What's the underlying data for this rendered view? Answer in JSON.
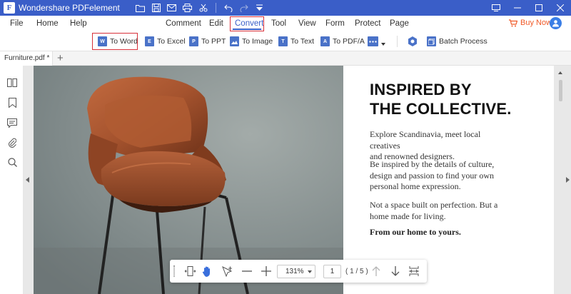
{
  "app": {
    "title": "Wondershare PDFelement"
  },
  "quick_access": [
    {
      "name": "open-folder-icon"
    },
    {
      "name": "save-icon"
    },
    {
      "name": "email-icon"
    },
    {
      "name": "print-icon"
    },
    {
      "name": "scissors-icon"
    },
    {
      "name": "undo-icon"
    },
    {
      "name": "redo-icon"
    },
    {
      "name": "customize-dropdown-icon"
    }
  ],
  "menu": {
    "items": [
      {
        "label": "File"
      },
      {
        "label": "Home"
      },
      {
        "label": "Help"
      },
      {
        "label": "Comment"
      },
      {
        "label": "Edit"
      },
      {
        "label": "Convert"
      },
      {
        "label": "Tool"
      },
      {
        "label": "View"
      },
      {
        "label": "Form"
      },
      {
        "label": "Protect"
      },
      {
        "label": "Page"
      }
    ],
    "active": "Convert",
    "buy_now": "Buy Now"
  },
  "toolbar": {
    "items": [
      {
        "label": "To Word",
        "icon": "W",
        "color": "#4a72c8"
      },
      {
        "label": "To Excel",
        "icon": "E",
        "color": "#4a72c8"
      },
      {
        "label": "To PPT",
        "icon": "P",
        "color": "#4a72c8"
      },
      {
        "label": "To Image",
        "icon": "img",
        "color": "#4a72c8"
      },
      {
        "label": "To Text",
        "icon": "T",
        "color": "#4a72c8"
      },
      {
        "label": "To PDF/A",
        "icon": "A",
        "color": "#4a72c8"
      }
    ],
    "batch": "Batch Process"
  },
  "tabs": [
    {
      "label": "Furniture.pdf *"
    }
  ],
  "document": {
    "headline": [
      "INSPIRED BY",
      "THE COLLECTIVE."
    ],
    "paragraphs": [
      [
        "Explore Scandinavia, meet local creatives",
        "and renowned designers."
      ],
      [
        "Be inspired by the details of culture,",
        "design and passion to find your own",
        "personal home expression."
      ],
      [
        "Not a space built on perfection. But a",
        "home made for living."
      ]
    ],
    "closing": "From our home to yours."
  },
  "zoom": {
    "value": "131%",
    "page_current": "1",
    "page_count": "( 1 / 5 )"
  },
  "colors": {
    "accent": "#3a5ec8",
    "highlight": "#d8313a",
    "buy_now": "#f05a28"
  }
}
